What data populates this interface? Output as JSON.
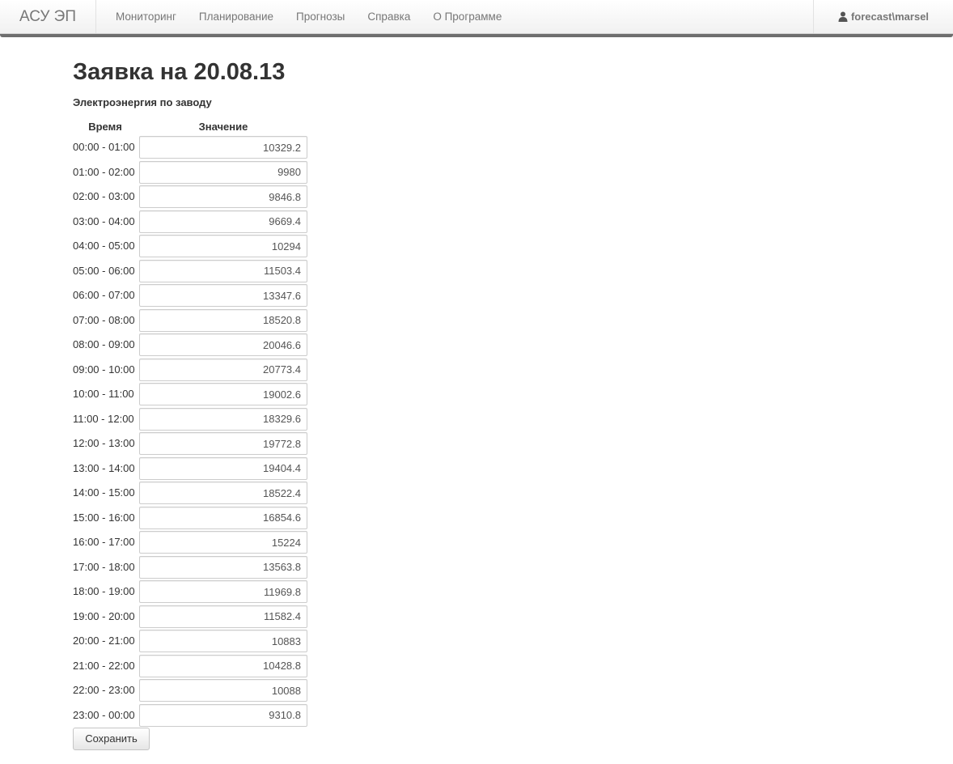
{
  "navbar": {
    "brand": "АСУ ЭП",
    "items": [
      {
        "label": "Мониторинг"
      },
      {
        "label": "Планирование"
      },
      {
        "label": "Прогнозы"
      },
      {
        "label": "Справка"
      },
      {
        "label": "О Программе"
      }
    ],
    "user": {
      "icon": "user-icon",
      "name": "forecast\\marsel"
    }
  },
  "page": {
    "title": "Заявка на 20.08.13",
    "subtitle": "Электроэнергия по заводу"
  },
  "table": {
    "headers": {
      "time": "Время",
      "value": "Значение"
    },
    "rows": [
      {
        "time": "00:00 - 01:00",
        "value": "10329.2"
      },
      {
        "time": "01:00 - 02:00",
        "value": "9980"
      },
      {
        "time": "02:00 - 03:00",
        "value": "9846.8"
      },
      {
        "time": "03:00 - 04:00",
        "value": "9669.4"
      },
      {
        "time": "04:00 - 05:00",
        "value": "10294"
      },
      {
        "time": "05:00 - 06:00",
        "value": "11503.4"
      },
      {
        "time": "06:00 - 07:00",
        "value": "13347.6"
      },
      {
        "time": "07:00 - 08:00",
        "value": "18520.8"
      },
      {
        "time": "08:00 - 09:00",
        "value": "20046.6"
      },
      {
        "time": "09:00 - 10:00",
        "value": "20773.4"
      },
      {
        "time": "10:00 - 11:00",
        "value": "19002.6"
      },
      {
        "time": "11:00 - 12:00",
        "value": "18329.6"
      },
      {
        "time": "12:00 - 13:00",
        "value": "19772.8"
      },
      {
        "time": "13:00 - 14:00",
        "value": "19404.4"
      },
      {
        "time": "14:00 - 15:00",
        "value": "18522.4"
      },
      {
        "time": "15:00 - 16:00",
        "value": "16854.6"
      },
      {
        "time": "16:00 - 17:00",
        "value": "15224"
      },
      {
        "time": "17:00 - 18:00",
        "value": "13563.8"
      },
      {
        "time": "18:00 - 19:00",
        "value": "11969.8"
      },
      {
        "time": "19:00 - 20:00",
        "value": "11582.4"
      },
      {
        "time": "20:00 - 21:00",
        "value": "10883"
      },
      {
        "time": "21:00 - 22:00",
        "value": "10428.8"
      },
      {
        "time": "22:00 - 23:00",
        "value": "10088"
      },
      {
        "time": "23:00 - 00:00",
        "value": "9310.8"
      }
    ]
  },
  "actions": {
    "save_label": "Сохранить"
  }
}
